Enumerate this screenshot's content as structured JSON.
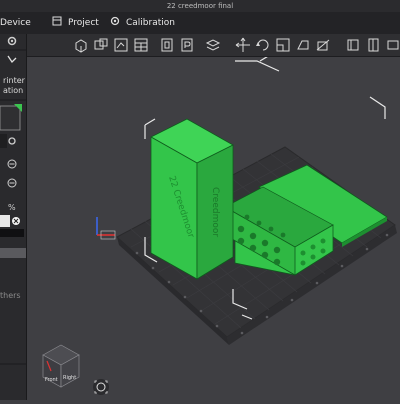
{
  "window": {
    "title": "22 creedmoor final"
  },
  "tabs": [
    {
      "label": "Device"
    },
    {
      "label": "Project"
    },
    {
      "label": "Calibration"
    }
  ],
  "sidebar": {
    "printer_label_1": "rinter",
    "printer_label_2": "ation",
    "others_label": "thers"
  },
  "toolbar": {
    "icons": [
      "add-icon",
      "auto-orient-icon",
      "arrange-icon",
      "plates-icon",
      "split-object-icon",
      "split-parts-icon",
      "move-icon",
      "rotate-icon",
      "scale-icon",
      "lay-on-face-icon",
      "cut-icon",
      "support-paint-icon",
      "seam-paint-icon",
      "measure-icon"
    ]
  },
  "model": {
    "text_a": "22 Creedmoor",
    "text_b": "Creedmoor",
    "color": "#33c54a",
    "color_dark": "#1d8f30",
    "color_edge": "#0f5c1d"
  },
  "viewcube": {
    "front": "Front",
    "right": "Right"
  }
}
